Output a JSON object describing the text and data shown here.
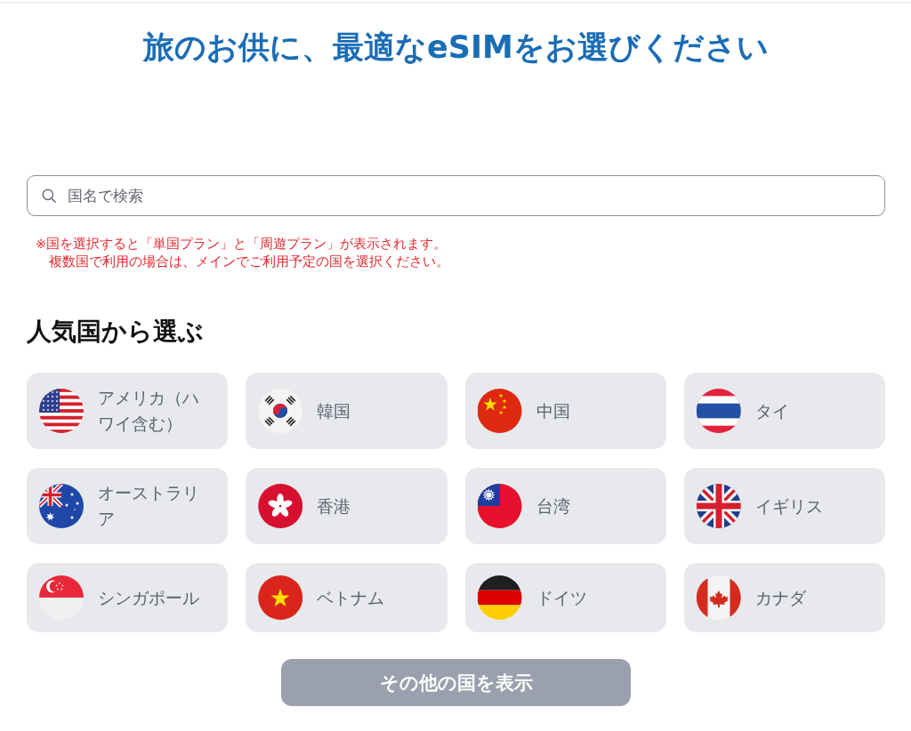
{
  "title": "旅のお供に、最適なeSIMをお選びください",
  "search": {
    "placeholder": "国名で検索"
  },
  "notes": [
    "※国を選択すると「単国プラン」と「周遊プラン」が表示されます。",
    "複数国で利用の場合は、メインでご利用予定の国を選択ください。"
  ],
  "popular": {
    "heading": "人気国から選ぶ",
    "countries": [
      {
        "name": "アメリカ（ハワイ含む）"
      },
      {
        "name": "韓国"
      },
      {
        "name": "中国"
      },
      {
        "name": "タイ"
      },
      {
        "name": "オーストラリア"
      },
      {
        "name": "香港"
      },
      {
        "name": "台湾"
      },
      {
        "name": "イギリス"
      },
      {
        "name": "シンガポール"
      },
      {
        "name": "ベトナム"
      },
      {
        "name": "ドイツ"
      },
      {
        "name": "カナダ"
      }
    ]
  },
  "more_button": "その他の国を表示"
}
